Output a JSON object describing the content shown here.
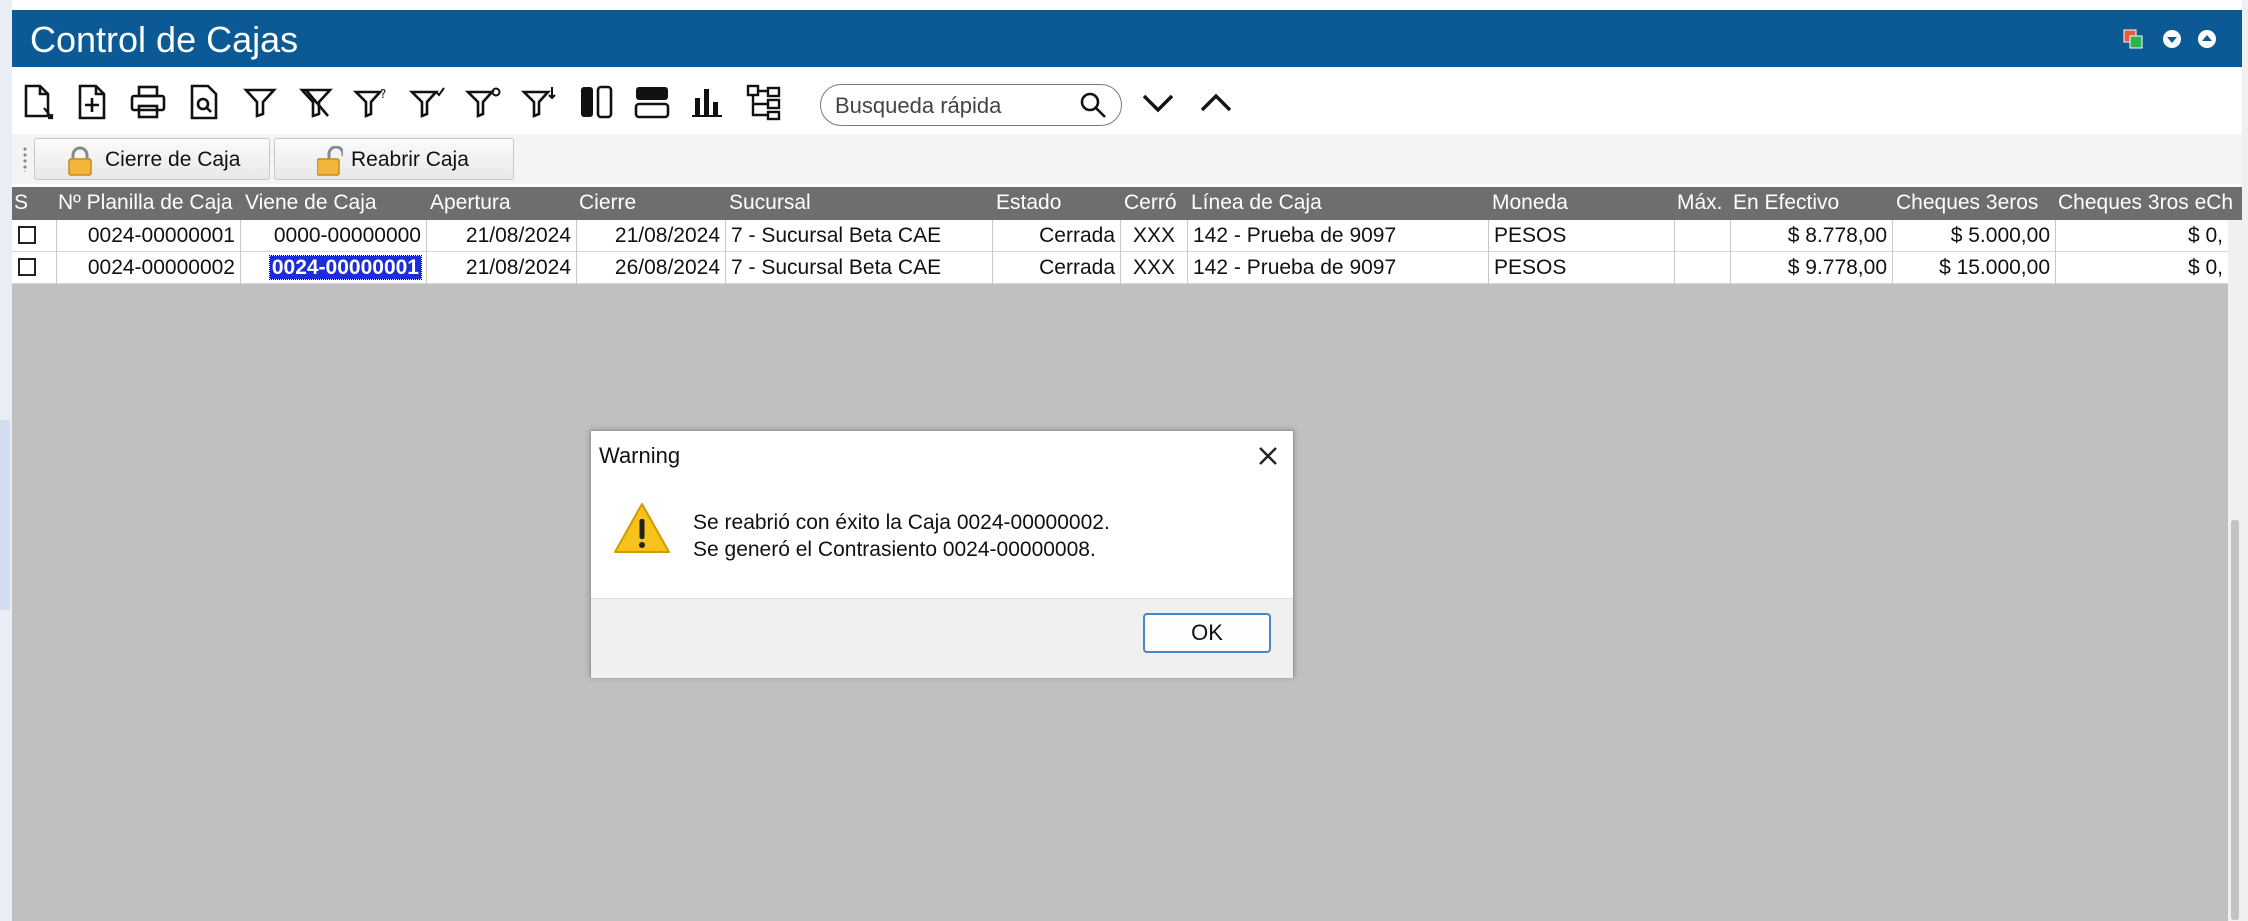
{
  "window": {
    "title": "Control de Cajas"
  },
  "search": {
    "placeholder": "Busqueda rápida"
  },
  "actions": {
    "cierre_label": "Cierre de Caja",
    "reabrir_label": "Reabrir Caja"
  },
  "table": {
    "headers": [
      "S",
      "Nº Planilla de Caja",
      "Viene de Caja",
      "Apertura",
      "Cierre",
      "Sucursal",
      "Estado",
      "Cerró",
      "Línea de Caja",
      "Moneda",
      "Máx.",
      "En Efectivo",
      "Cheques 3eros",
      "Cheques 3ros eCh"
    ],
    "rows": [
      [
        "",
        "0024-00000001",
        "0000-00000000",
        "21/08/2024",
        "21/08/2024",
        "7 - Sucursal Beta CAE",
        "Cerrada",
        "XXX",
        "142 - Prueba de 9097",
        "PESOS",
        "",
        "$ 8.778,00",
        "$ 5.000,00",
        "$ 0,"
      ],
      [
        "",
        "0024-00000002",
        "0024-00000001",
        "21/08/2024",
        "26/08/2024",
        "7 - Sucursal Beta CAE",
        "Cerrada",
        "XXX",
        "142 - Prueba de 9097",
        "PESOS",
        "",
        "$ 9.778,00",
        "$ 15.000,00",
        "$ 0,"
      ]
    ]
  },
  "dialog": {
    "title": "Warning",
    "line1": "Se reabrió con éxito la Caja 0024-00000002.",
    "line2": "Se generó el Contrasiento 0024-00000008.",
    "ok_label": "OK"
  }
}
